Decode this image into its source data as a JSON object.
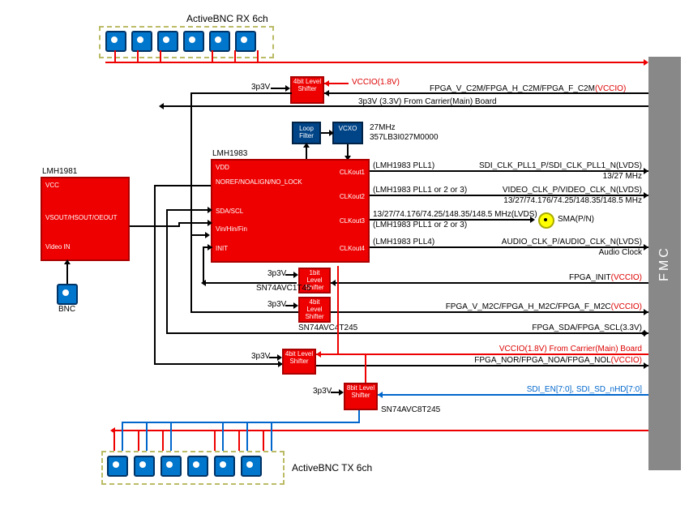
{
  "title_top": "ActiveBNC RX 6ch",
  "title_bot": "ActiveBNC TX 6ch",
  "bnc_label": "BNC",
  "lmh1981": {
    "name": "LMH1981",
    "vcc": "VCC",
    "pins": "VSOUT/HSOUT/OEOUT",
    "vin": "Video IN"
  },
  "lmh1983": {
    "name": "LMH1983",
    "vdd": "VDD",
    "noref": "NOREF/NOALIGN/NO_LOCK",
    "sda": "SDA/SCL",
    "vin": "Vin/Hin/Fin",
    "init": "INIT",
    "clk1": "CLKout1",
    "clk2": "CLKout2",
    "clk3": "CLKout3",
    "clk4": "CLKout4"
  },
  "loopfilter": "Loop Filter",
  "vcxo": "VCXO",
  "vcxo_freq": "27MHz",
  "vcxo_part": "357LB3I027M0000",
  "shifter4": "4bit Level Shifter",
  "shifter1": "1bit Level Shifter",
  "shifter8": "8bit Level Shifter",
  "part_1bit": "SN74AVC1T45",
  "part_4bit": "SN74AVC4T245",
  "part_8bit": "SN74AVC8T245",
  "volt_3p3": "3p3V",
  "volt_3p3full": "3p3V (3.3V) From Carrier(Main) Board",
  "vccio18": "VCCIO(1.8V)",
  "vccio18_carrier": "VCCIO(1.8V)  From Carrier(Main) Board",
  "fmc": "FMC",
  "sma_label": "SMA(P/N)",
  "signals": {
    "c2m": "FPGA_V_C2M/FPGA_H_C2M/FPGA_F_C2M",
    "c2m_v": "(VCCIO)",
    "pll1": "(LMH1983 PLL1)",
    "sdi_clk": "SDI_CLK_PLL1_P/SDI_CLK_PLL1_N(LVDS)",
    "sdi_freq": "13/27 MHz",
    "pll123": "(LMH1983 PLL1 or 2 or 3)",
    "video_clk": "VIDEO_CLK_P/VIDEO_CLK_N(LVDS)",
    "video_freq": "13/27/74.176/74.25/148.35/148.5  MHz",
    "clk3_freq": "13/27/74.176/74.25/148.35/148.5  MHz(LVDS)",
    "pll4": "(LMH1983 PLL4)",
    "audio_clk": "AUDIO_CLK_P/AUDIO_CLK_N(LVDS)",
    "audio_sub": "Audio Clock",
    "fpga_init": "FPGA_INIT",
    "fpga_init_v": "(VCCIO)",
    "m2c": "FPGA_V_M2C/FPGA_H_M2C/FPGA_F_M2C",
    "m2c_v": "(VCCIO)",
    "sda_scl": "FPGA_SDA/FPGA_SCL(3.3V)",
    "nor_noa": "FPGA_NOR/FPGA_NOA/FPGA_NOL",
    "nor_noa_v": "(VCCIO)",
    "sdi_en": "SDI_EN[7:0], SDI_SD_nHD[7:0]"
  }
}
